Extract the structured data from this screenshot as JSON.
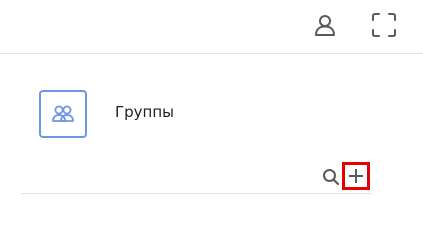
{
  "header": {
    "icons": [
      "user-icon",
      "fullscreen-icon"
    ]
  },
  "group": {
    "label": "Группы",
    "icon": "group-icon",
    "accent": "#6f95e6"
  },
  "toolbar": {
    "icons": [
      "search-icon",
      "plus-icon"
    ],
    "highlight_color": "#e60000"
  }
}
